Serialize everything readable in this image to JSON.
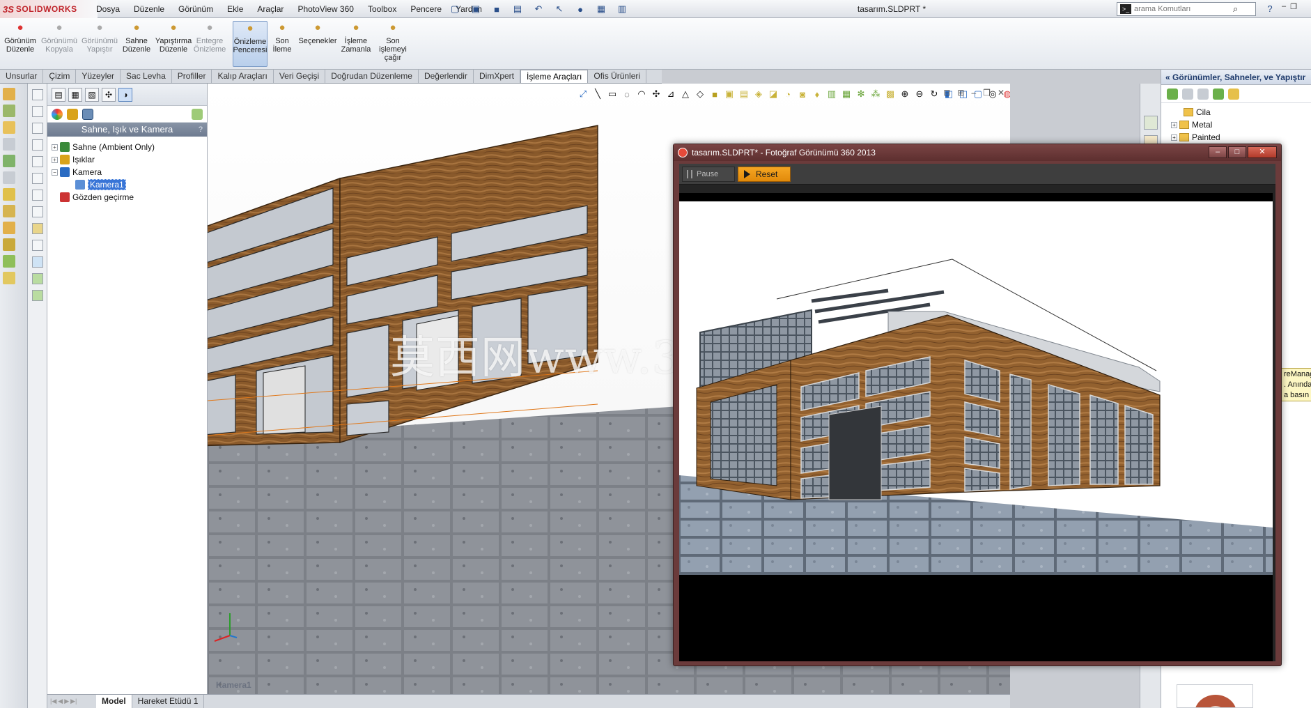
{
  "app": {
    "logo_ds": "3S",
    "logo_name": "SOLIDWORKS",
    "document_title": "tasarım.SLDPRT *"
  },
  "menu": [
    "Dosya",
    "Düzenle",
    "Görünüm",
    "Ekle",
    "Araçlar",
    "PhotoView 360",
    "Toolbox",
    "Pencere",
    "Yardım"
  ],
  "search": {
    "placeholder": "arama Komutları"
  },
  "ribbon": [
    {
      "label": "Görünüm\nDüzenle",
      "icon": "appearance-icon",
      "dim": false,
      "active": false
    },
    {
      "label": "Görünümü\nKopyala",
      "icon": "copy-appearance-icon",
      "dim": true,
      "active": false
    },
    {
      "label": "Görünümü\nYapıştır",
      "icon": "paste-appearance-icon",
      "dim": true,
      "active": false
    },
    {
      "label": "Sahne\nDüzenle",
      "icon": "scene-icon",
      "dim": false,
      "active": false
    },
    {
      "label": "Yapıştırma\nDüzenle",
      "icon": "decal-icon",
      "dim": false,
      "active": false
    },
    {
      "label": "Entegre\nÖnizleme",
      "icon": "integrated-preview-icon",
      "dim": true,
      "active": false
    },
    {
      "label": "Önizleme\nPenceresi",
      "icon": "preview-window-icon",
      "dim": false,
      "active": true
    },
    {
      "label": "Son\nİleme",
      "icon": "final-render-icon",
      "dim": false,
      "active": false
    },
    {
      "label": "Seçenekler",
      "icon": "options-icon",
      "dim": false,
      "active": false
    },
    {
      "label": "İşleme\nZamanla",
      "icon": "schedule-render-icon",
      "dim": false,
      "active": false
    },
    {
      "label": "Son\nişlemeyi\nçağır",
      "icon": "recall-render-icon",
      "dim": false,
      "active": false
    }
  ],
  "tabs": [
    "Unsurlar",
    "Çizim",
    "Yüzeyler",
    "Sac Levha",
    "Profiller",
    "Kalıp Araçları",
    "Veri Geçişi",
    "Doğrudan Düzenleme",
    "Değerlendir",
    "DimXpert",
    "İşleme Araçları",
    "Ofis Ürünleri"
  ],
  "active_tab": "İşleme Araçları",
  "property_manager": {
    "header": "Sahne, Işık ve Kamera",
    "help": "?",
    "tree": [
      {
        "label": "Sahne (Ambient Only)",
        "level": 0,
        "expand": "+",
        "icon": "scene-icon"
      },
      {
        "label": "Işıklar",
        "level": 0,
        "expand": "+",
        "icon": "lights-icon"
      },
      {
        "label": "Kamera",
        "level": 0,
        "expand": "−",
        "icon": "camera-folder-icon"
      },
      {
        "label": "Kamera1",
        "level": 1,
        "expand": "",
        "icon": "camera-icon",
        "selected": true
      },
      {
        "label": "Gözden geçirme",
        "level": 0,
        "expand": "",
        "icon": "walkthrough-icon"
      }
    ]
  },
  "viewport": {
    "camera_label": "Kamera1",
    "watermark": "莫西网www.3dmox.com"
  },
  "bottom_tabs": [
    "Model",
    "Hareket Etüdü 1"
  ],
  "task_pane": {
    "header": "Görünümler, Sahneler, ve Yapıştır",
    "tree": [
      "Cila",
      "Metal",
      "Painted"
    ],
    "tooltip": "reManag\n. Anında\na basın v"
  },
  "photoview": {
    "title": "tasarım.SLDPRT* - Fotoğraf Görünümü 360 2013",
    "pause_label": "Pause",
    "reset_label": "Reset"
  }
}
